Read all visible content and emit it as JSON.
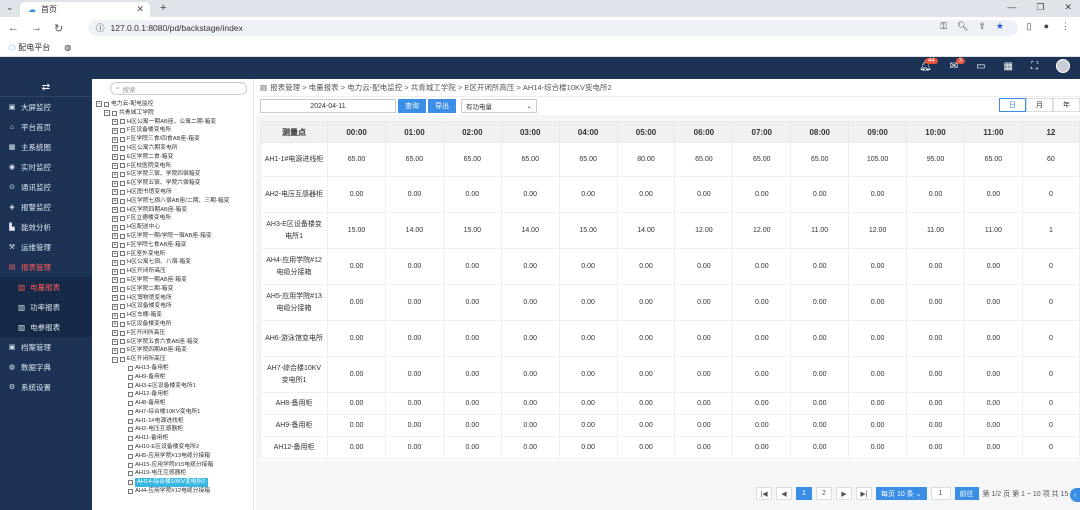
{
  "browser": {
    "tab_title": "首页",
    "url": "127.0.0.1:8080/pd/backstage/index",
    "bookmark1": "配电平台"
  },
  "header": {
    "badge_bell": "44",
    "badge_msg": "3"
  },
  "sidebar": {
    "items": [
      {
        "label": "大屏监控",
        "icon": "monitor-icon"
      },
      {
        "label": "平台首页",
        "icon": "home-icon"
      },
      {
        "label": "主系统图",
        "icon": "diagram-icon"
      },
      {
        "label": "实时监控",
        "icon": "location-icon"
      },
      {
        "label": "通讯监控",
        "icon": "comm-icon"
      },
      {
        "label": "报警监控",
        "icon": "alarm-icon"
      },
      {
        "label": "能效分析",
        "icon": "chart-icon"
      },
      {
        "label": "运维管理",
        "icon": "tools-icon"
      },
      {
        "label": "报表管理",
        "icon": "report-icon",
        "active": true
      }
    ],
    "subitems": [
      {
        "label": "电量报表",
        "active": true
      },
      {
        "label": "功率报表"
      },
      {
        "label": "电参报表"
      }
    ],
    "bottom": [
      {
        "label": "档案管理"
      },
      {
        "label": "数据字典"
      },
      {
        "label": "系统设置"
      }
    ]
  },
  "tree": {
    "search_placeholder": "搜索",
    "nodes": [
      {
        "t": "电力云-配电监控",
        "lvl": 0,
        "k": "m"
      },
      {
        "t": "共青城工学院",
        "lvl": 1,
        "k": "m"
      },
      {
        "t": "H区公寓一期AB座、公寓二期-箱变",
        "lvl": 2,
        "k": "p"
      },
      {
        "t": "F区设备楼变电所",
        "lvl": 2,
        "k": "p"
      },
      {
        "t": "F区学院三食/四食AB座-箱变",
        "lvl": 2,
        "k": "p"
      },
      {
        "t": "H区公寓六期变电所",
        "lvl": 2,
        "k": "p"
      },
      {
        "t": "E区学院二食-箱变",
        "lvl": 2,
        "k": "p"
      },
      {
        "t": "F区校医院变电所",
        "lvl": 2,
        "k": "p"
      },
      {
        "t": "E区学院三宿、学院四宿箱变",
        "lvl": 2,
        "k": "p"
      },
      {
        "t": "E区学院五宿、学院六宿箱变",
        "lvl": 2,
        "k": "p"
      },
      {
        "t": "H区图书馆变电所",
        "lvl": 2,
        "k": "p"
      },
      {
        "t": "H区学院七宿八宿AB座/二期、三期-箱变",
        "lvl": 2,
        "k": "p"
      },
      {
        "t": "H区学院四期AB座-箱变",
        "lvl": 2,
        "k": "p"
      },
      {
        "t": "F区立德楼变电所",
        "lvl": 2,
        "k": "p"
      },
      {
        "t": "H区配送中心",
        "lvl": 2,
        "k": "p"
      },
      {
        "t": "E区学院一期/学院一宿AB座-箱变",
        "lvl": 2,
        "k": "p"
      },
      {
        "t": "F区学院七食AB座-箱变",
        "lvl": 2,
        "k": "p"
      },
      {
        "t": "F区室外变电所",
        "lvl": 2,
        "k": "p"
      },
      {
        "t": "H区公寓七宿、八宿-箱变",
        "lvl": 2,
        "k": "p"
      },
      {
        "t": "H区开闭所高压",
        "lvl": 2,
        "k": "p"
      },
      {
        "t": "E区学院一期AB座-箱变",
        "lvl": 2,
        "k": "p"
      },
      {
        "t": "E区学院二期-箱变",
        "lvl": 2,
        "k": "p"
      },
      {
        "t": "H区博物馆变电所",
        "lvl": 2,
        "k": "p"
      },
      {
        "t": "H区设备楼变电所",
        "lvl": 2,
        "k": "p"
      },
      {
        "t": "H区车棚-箱变",
        "lvl": 2,
        "k": "p"
      },
      {
        "t": "E区设备楼变电所",
        "lvl": 2,
        "k": "p"
      },
      {
        "t": "F区开闭所高压",
        "lvl": 2,
        "k": "p"
      },
      {
        "t": "E区学院五食六食AB座-箱变",
        "lvl": 2,
        "k": "p"
      },
      {
        "t": "E区学院四期AB座-箱变",
        "lvl": 2,
        "k": "p"
      },
      {
        "t": "E区开闭所高压",
        "lvl": 2,
        "k": "m"
      },
      {
        "t": "AH13-备用柜",
        "lvl": 3,
        "k": "c"
      },
      {
        "t": "AH9-备用柜",
        "lvl": 3,
        "k": "c"
      },
      {
        "t": "AH3-E区设备楼变电所1",
        "lvl": 3,
        "k": "c"
      },
      {
        "t": "AH12-备用柜",
        "lvl": 3,
        "k": "c"
      },
      {
        "t": "AH8-备用柜",
        "lvl": 3,
        "k": "c"
      },
      {
        "t": "AH7-综合楼10KV变电所1",
        "lvl": 3,
        "k": "c"
      },
      {
        "t": "AH1-1#电源进线柜",
        "lvl": 3,
        "k": "c"
      },
      {
        "t": "AH2-电压互感器柜",
        "lvl": 3,
        "k": "c"
      },
      {
        "t": "AH11-备用柜",
        "lvl": 3,
        "k": "c"
      },
      {
        "t": "AH10-E区设备楼变电所2",
        "lvl": 3,
        "k": "c"
      },
      {
        "t": "AH5-应用学院#13电缆分接箱",
        "lvl": 3,
        "k": "c"
      },
      {
        "t": "AH15-应用学院#15电缆分接箱",
        "lvl": 3,
        "k": "c"
      },
      {
        "t": "AH19-电压互感器柜",
        "lvl": 3,
        "k": "c"
      },
      {
        "t": "AH14-综合楼10KV变电所2",
        "lvl": 3,
        "k": "c",
        "sel": true
      },
      {
        "t": "AH4-应用学院#12电缆分接箱",
        "lvl": 3,
        "k": "c"
      }
    ]
  },
  "breadcrumb": "报表管理 / 电量报表 / 电力云-配电监控 / 共青城工学院 / E区开闭所高压 / AH14-综合楼10KV变电所2",
  "breadcrumb_parts": [
    "报表管理",
    "电量报表",
    "电力云-配电监控",
    "共青城工学院",
    "E区开闭所高压",
    "AH14-综合楼10KV变电所2"
  ],
  "toolbar": {
    "date": "2024-04-11",
    "query": "查询",
    "export": "导出",
    "select": "有功电量",
    "period": [
      "日",
      "月",
      "年"
    ]
  },
  "table": {
    "first_header": "测量点",
    "hours": [
      "00:00",
      "01:00",
      "02:00",
      "03:00",
      "04:00",
      "05:00",
      "06:00",
      "07:00",
      "08:00",
      "09:00",
      "10:00",
      "11:00",
      "12"
    ],
    "rows": [
      {
        "name": "AH1-1#电源进线柜",
        "values": [
          "65.00",
          "65.00",
          "65.00",
          "65.00",
          "65.00",
          "80.00",
          "65.00",
          "65.00",
          "65.00",
          "105.00",
          "95.00",
          "65.00",
          "60"
        ]
      },
      {
        "name": "AH2-电压互感器柜",
        "values": [
          "0.00",
          "0.00",
          "0.00",
          "0.00",
          "0.00",
          "0.00",
          "0.00",
          "0.00",
          "0.00",
          "0.00",
          "0.00",
          "0.00",
          "0"
        ]
      },
      {
        "name": "AH3-E区设备楼变电所1",
        "values": [
          "15.00",
          "14.00",
          "15.00",
          "14.00",
          "15.00",
          "14.00",
          "12.00",
          "12.00",
          "11.00",
          "12.00",
          "11.00",
          "11.00",
          "1"
        ]
      },
      {
        "name": "AH4-应用学院#12电缆分接箱",
        "values": [
          "0.00",
          "0.00",
          "0.00",
          "0.00",
          "0.00",
          "0.00",
          "0.00",
          "0.00",
          "0.00",
          "0.00",
          "0.00",
          "0.00",
          "0"
        ]
      },
      {
        "name": "AH5-应用学院#13电缆分接箱",
        "values": [
          "0.00",
          "0.00",
          "0.00",
          "0.00",
          "0.00",
          "0.00",
          "0.00",
          "0.00",
          "0.00",
          "0.00",
          "0.00",
          "0.00",
          "0"
        ]
      },
      {
        "name": "AH6-游泳馆变电所",
        "values": [
          "0.00",
          "0.00",
          "0.00",
          "0.00",
          "0.00",
          "0.00",
          "0.00",
          "0.00",
          "0.00",
          "0.00",
          "0.00",
          "0.00",
          "0"
        ]
      },
      {
        "name": "AH7-综合楼10KV变电所1",
        "values": [
          "0.00",
          "0.00",
          "0.00",
          "0.00",
          "0.00",
          "0.00",
          "0.00",
          "0.00",
          "0.00",
          "0.00",
          "0.00",
          "0.00",
          "0"
        ]
      },
      {
        "name": "AH8-备用柜",
        "values": [
          "0.00",
          "0.00",
          "0.00",
          "0.00",
          "0.00",
          "0.00",
          "0.00",
          "0.00",
          "0.00",
          "0.00",
          "0.00",
          "0.00",
          "0"
        ]
      },
      {
        "name": "AH9-备用柜",
        "values": [
          "0.00",
          "0.00",
          "0.00",
          "0.00",
          "0.00",
          "0.00",
          "0.00",
          "0.00",
          "0.00",
          "0.00",
          "0.00",
          "0.00",
          "0"
        ]
      },
      {
        "name": "AH12-备用柜",
        "values": [
          "0.00",
          "0.00",
          "0.00",
          "0.00",
          "0.00",
          "0.00",
          "0.00",
          "0.00",
          "0.00",
          "0.00",
          "0.00",
          "0.00",
          "0"
        ]
      }
    ]
  },
  "pager": {
    "pages": [
      "1",
      "2"
    ],
    "size": "每页 10 条",
    "jump_value": "1",
    "jump": "前往",
    "info": "第 1/2 页  第 1 ~ 10 项  共 15 项"
  }
}
